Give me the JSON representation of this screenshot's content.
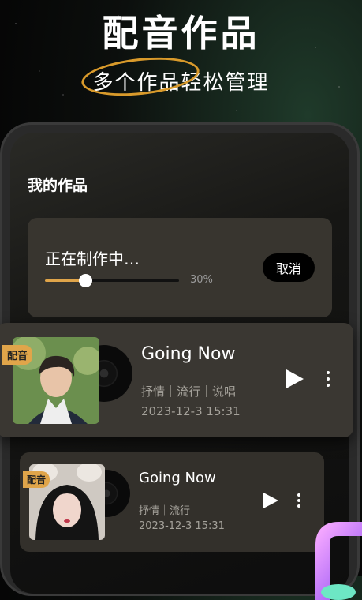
{
  "hero": {
    "title": "配音作品",
    "subtitle_highlight": "多个作品",
    "subtitle_rest": "轻松管理"
  },
  "section": {
    "title": "我的作品"
  },
  "progress": {
    "label": "正在制作中…",
    "percent_text": "30%",
    "value": 0.3,
    "cancel_label": "取消"
  },
  "tracks": [
    {
      "tag": "配音",
      "title": "Going Now",
      "tags": "抒情｜流行｜说唱",
      "date": "2023-12-3 15:31"
    },
    {
      "tag": "配音",
      "title": "Going Now",
      "tags": "抒情｜流行",
      "date": "2023-12-3 15:31"
    }
  ],
  "colors": {
    "accent": "#e0a54a",
    "card": "#3a3732",
    "background": "#0c0f0d"
  }
}
